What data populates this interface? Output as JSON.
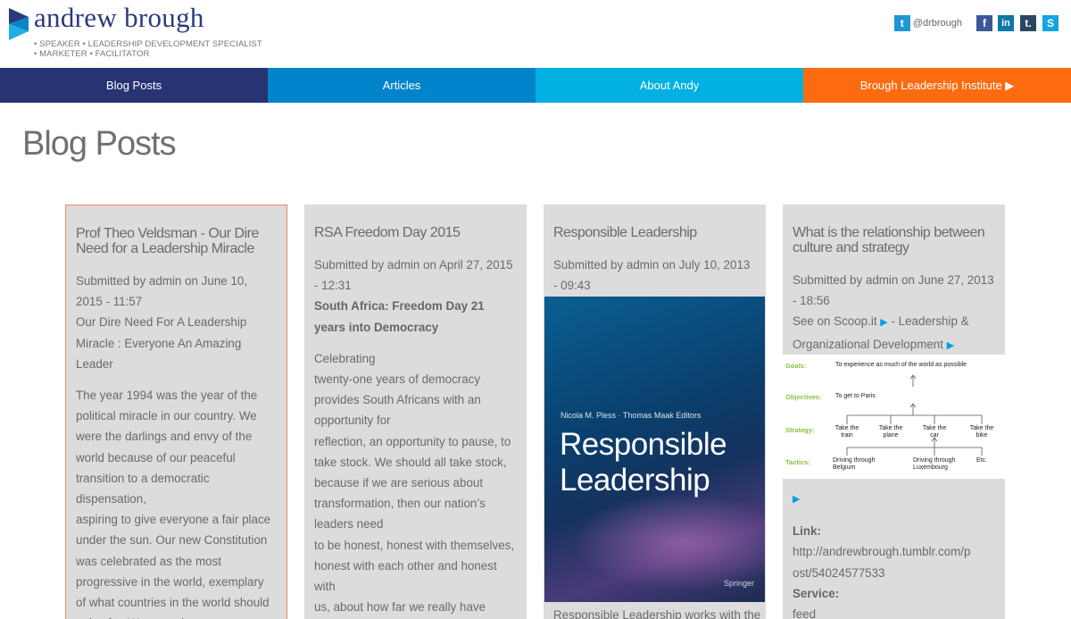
{
  "header": {
    "logo_title": "andrew brough",
    "tagline_1": "• SPEAKER • LEADERSHIP DEVELOPMENT SPECIALIST",
    "tagline_2": "• MARKETER • FACILITATOR",
    "twitter_handle": "@drbrough",
    "social": {
      "twitter_glyph": "t",
      "facebook_glyph": "f",
      "linkedin_glyph": "in",
      "tumblr_glyph": "t.",
      "skype_glyph": "S"
    }
  },
  "nav": {
    "blog_posts": "Blog Posts",
    "articles": "Articles",
    "about": "About Andy",
    "institute": "Brough Leadership Institute ▶"
  },
  "page_title": "Blog Posts",
  "posts": [
    {
      "title": "Prof Theo Veldsman - Our Dire Need for a Leadership Miracle",
      "submitted": "Submitted by admin on June 10, 2015 - 11:57",
      "subtitle": "Our Dire Need For A Leadership Miracle : Everyone An Amazing Leader",
      "body": "The year 1994 was the year of the political miracle in our country. We were the darlings and envy of the world because of our peaceful transition to a democratic dispensation,",
      "body2": "aspiring to give everyone a fair place under the sun. Our new Constitution was celebrated as the most progressive in the world, exemplary of what countries in the world should strive for. We were the"
    },
    {
      "title": "RSA Freedom Day 2015",
      "submitted": "Submitted by admin on April 27, 2015 - 12:31",
      "subtitle": "South Africa: Freedom Day 21 years into Democracy",
      "line1": "Celebrating",
      "line2": "twenty-one years of democracy provides South Africans with an opportunity for",
      "line3": "reflection, an opportunity to pause, to take stock. We should all take stock, because if we are serious about transformation, then our nation’s leaders need",
      "line4": "to be honest, honest with themselves, honest with each other and honest with",
      "line5": "us, about how far we really have come"
    },
    {
      "title": "Responsible Leadership",
      "submitted": "Submitted by admin on July 10, 2013 - 09:43",
      "book_editors": "Nicola M. Pless · Thomas Maak  Editors",
      "book_title": "Responsible Leadership",
      "book_publisher": "Springer",
      "after": "Responsible Leadership works with the"
    },
    {
      "title": "What is the relationship between culture and strategy",
      "submitted": "Submitted by admin on June 27, 2013 - 18:56",
      "scoop_prefix": "See on Scoop.it",
      "scoop_topic": " - Leadership & Organizational Development",
      "diagram": {
        "goals_label": "Goals:",
        "goals_text": "To experience as much of the world as possible",
        "objectives_label": "Objectives:",
        "objectives_text": "To get to Paris",
        "strategy_label": "Strategy:",
        "s1": "Take the train",
        "s2": "Take the plane",
        "s3": "Take the car",
        "s4": "Take the bike",
        "tactics_label": "Tactics:",
        "t1": "Driving through Belgium",
        "t2": "Driving through Luxembourg",
        "t3": "Etc."
      },
      "link_label": "Link:",
      "link_url": "http://andrewbrough.tumblr.com/post/54024577533",
      "service_label": "Service:",
      "service_value": "feed"
    }
  ],
  "colors": {
    "nav_1": "#283373",
    "nav_2": "#0284cc",
    "nav_3": "#03b0e3",
    "nav_4": "#fc6b0f",
    "brand": "#2a3a7c"
  }
}
